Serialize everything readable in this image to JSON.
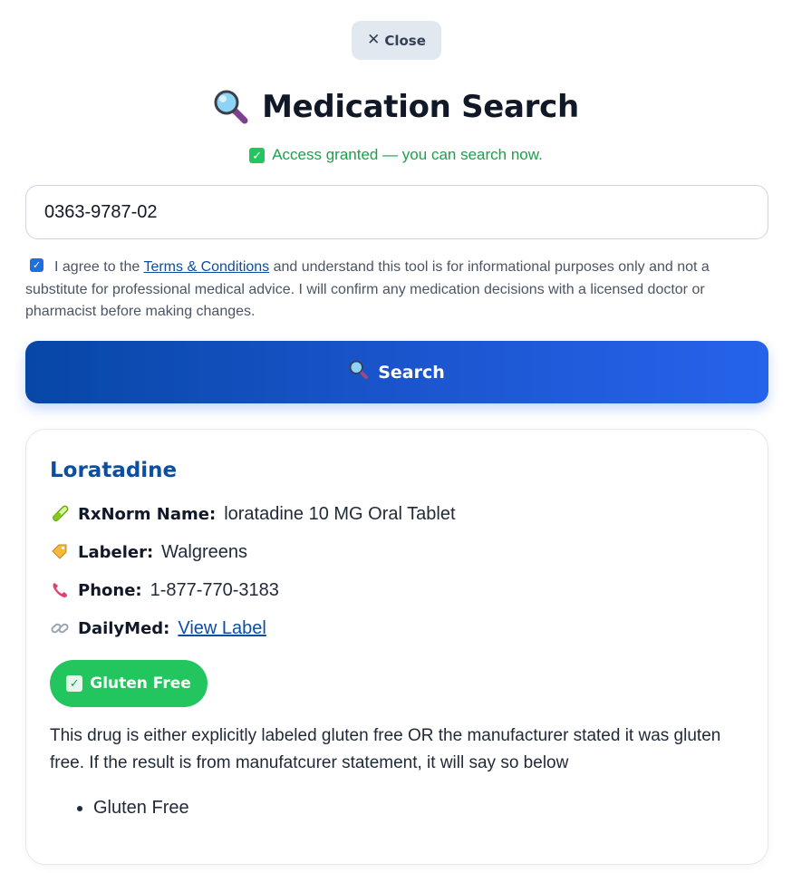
{
  "close_button": {
    "label": "Close",
    "icon": "close-icon"
  },
  "header": {
    "title": "Medication Search",
    "icon": "magnifying-glass-icon"
  },
  "status": {
    "text": "Access granted — you can search now.",
    "icon": "check-box-icon",
    "color": "#16a34a"
  },
  "search": {
    "value": "0363-9787-02"
  },
  "terms": {
    "checked": true,
    "prefix": "I agree to the ",
    "link_text": "Terms & Conditions",
    "suffix": " and understand this tool is for informational purposes only and not a substitute for professional medical advice. I will confirm any medication decisions with a licensed doctor or pharmacist before making changes."
  },
  "search_button": {
    "label": "Search",
    "icon": "magnifying-glass-icon"
  },
  "result": {
    "name": "Loratadine",
    "rxnorm_label": "RxNorm Name:",
    "rxnorm_value": "loratadine 10 MG Oral Tablet",
    "labeler_label": "Labeler:",
    "labeler_value": "Walgreens",
    "phone_label": "Phone:",
    "phone_value": "1-877-770-3183",
    "dailymed_label": "DailyMed:",
    "dailymed_link": "View Label",
    "badge": "Gluten Free",
    "badge_color": "#22c55e",
    "description": "This drug is either explicitly labeled gluten free OR the manufacturer stated it was gluten free. If the result is from manufatcurer statement, it will say so below",
    "statements": [
      "Gluten Free"
    ]
  },
  "colors": {
    "brand": "#0b4ea2",
    "button_gradient_start": "#0747a6",
    "button_gradient_end": "#2563eb"
  }
}
